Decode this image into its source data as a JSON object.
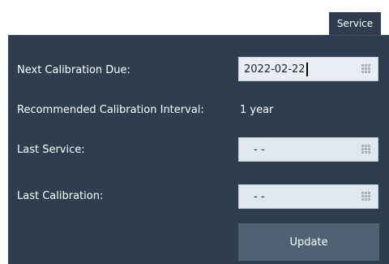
{
  "tab": {
    "label": "Service"
  },
  "rows": {
    "next_due": {
      "label": "Next Calibration Due:",
      "value": "2022-02-22"
    },
    "interval": {
      "label": "Recommended Calibration Interval:",
      "value": "1 year"
    },
    "last_service": {
      "label": "Last Service:",
      "value": "- -"
    },
    "last_calibration": {
      "label": "Last Calibration:",
      "value": "- -"
    }
  },
  "update_button": {
    "label": "Update"
  },
  "icons": {
    "field_keypad": "keypad-icon"
  },
  "colors": {
    "panel": "#2e3e4f",
    "field": "#dfe7ef",
    "button": "#4e6274"
  }
}
